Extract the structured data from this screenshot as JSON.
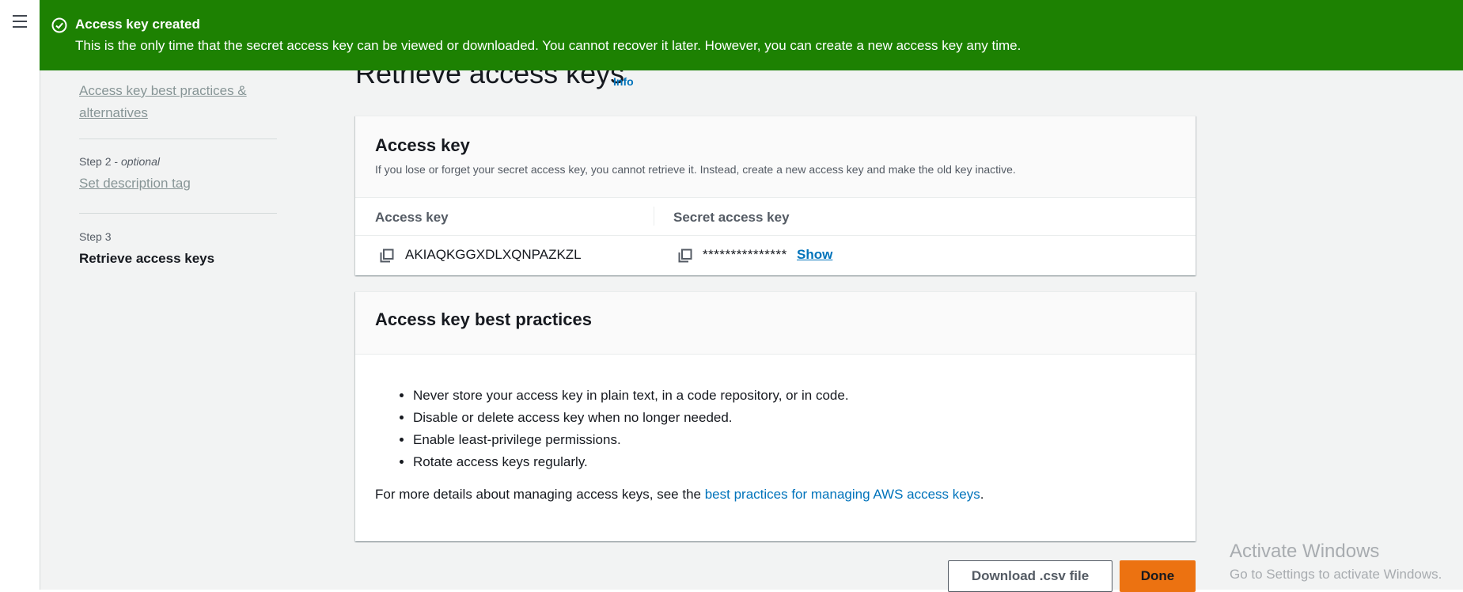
{
  "flash": {
    "title": "Access key created",
    "message": "This is the only time that the secret access key can be viewed or downloaded. You cannot recover it later. However, you can create a new access key any time.",
    "icon": "check-circle-icon",
    "color": "#1d8102"
  },
  "nav": {
    "menu_icon": "hamburger-menu-icon"
  },
  "steps": {
    "step1_link": "Access key best practices & alternatives",
    "step2_label": "Step 2",
    "step2_optional": "optional",
    "step2_link": "Set description tag",
    "step3_label": "Step 3",
    "step3_current": "Retrieve access keys"
  },
  "page": {
    "title": "Retrieve access keys",
    "info_link": "Info"
  },
  "access_key_card": {
    "title": "Access key",
    "description": "If you lose or forget your secret access key, you cannot retrieve it. Instead, create a new access key and make the old key inactive.",
    "columns": [
      "Access key",
      "Secret access key"
    ],
    "access_key_value": "AKIAQKGGXDLXQNPAZKZL",
    "secret_masked": "***************",
    "show_link": "Show"
  },
  "best_practices_card": {
    "title": "Access key best practices",
    "items": [
      "Never store your access key in plain text, in a code repository, or in code.",
      "Disable or delete access key when no longer needed.",
      "Enable least-privilege permissions.",
      "Rotate access keys regularly."
    ],
    "more_prefix": "For more details about managing access keys, see the ",
    "more_link": "best practices for managing AWS access keys",
    "more_suffix": "."
  },
  "buttons": {
    "download": "Download .csv file",
    "done": "Done"
  },
  "watermark": {
    "title": "Activate Windows",
    "subtitle": "Go to Settings to activate Windows."
  },
  "colors": {
    "link": "#0073bb",
    "primary_button": "#ec7211",
    "success": "#1d8102"
  }
}
